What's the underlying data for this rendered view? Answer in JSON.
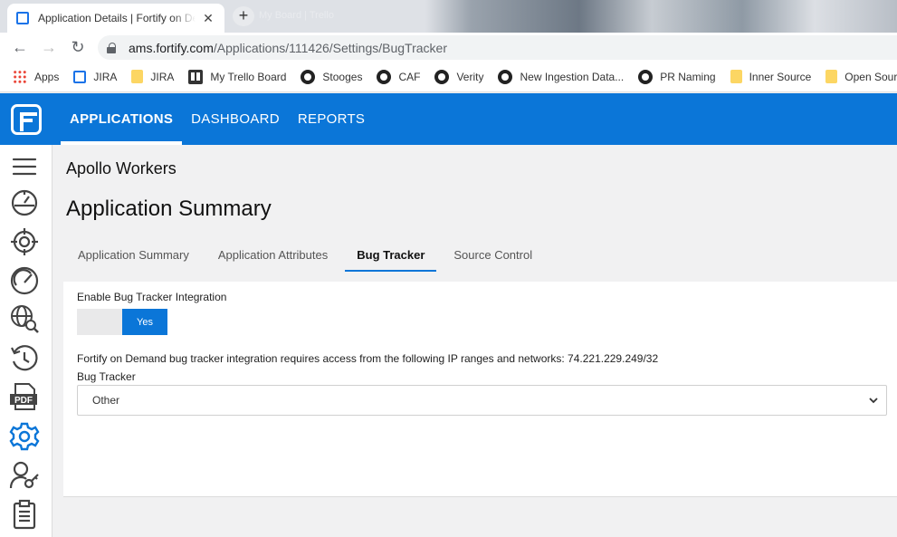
{
  "browser": {
    "tab_title": "Application Details | Fortify on Demand",
    "tab_close": "✕",
    "new_tab": "+",
    "ghost_tab_title": "My Board | Trello",
    "url_host": "ams.fortify.com",
    "url_path": "/Applications/111426/Settings/BugTracker",
    "bookmarks": [
      {
        "label": "Apps",
        "icon": "apps-grid-icon"
      },
      {
        "label": "JIRA",
        "icon": "jira-icon"
      },
      {
        "label": "JIRA",
        "icon": "folder-icon"
      },
      {
        "label": "My Trello Board",
        "icon": "trello-icon"
      },
      {
        "label": "Stooges",
        "icon": "github-icon"
      },
      {
        "label": "CAF",
        "icon": "github-icon"
      },
      {
        "label": "Verity",
        "icon": "github-icon"
      },
      {
        "label": "New Ingestion Data...",
        "icon": "github-icon"
      },
      {
        "label": "PR Naming",
        "icon": "github-icon"
      },
      {
        "label": "Inner Source",
        "icon": "folder-icon"
      },
      {
        "label": "Open Source",
        "icon": "folder-icon"
      }
    ]
  },
  "topnav": {
    "items": [
      "APPLICATIONS",
      "DASHBOARD",
      "REPORTS"
    ],
    "active": "APPLICATIONS"
  },
  "sidebar": {
    "icons": [
      "menu-icon",
      "dashboard-gauge-icon",
      "target-icon",
      "speedometer-icon",
      "globe-search-icon",
      "history-icon",
      "pdf-icon",
      "settings-gear-icon",
      "user-key-icon",
      "clipboard-icon"
    ]
  },
  "main": {
    "app_name": "Apollo Workers",
    "page_title": "Application Summary",
    "tabs": [
      {
        "label": "Application Summary"
      },
      {
        "label": "Application Attributes"
      },
      {
        "label": "Bug Tracker"
      },
      {
        "label": "Source Control"
      }
    ],
    "active_tab": "Bug Tracker",
    "enable_label": "Enable Bug Tracker Integration",
    "toggle_on_label": "Yes",
    "info_text": "Fortify on Demand bug tracker integration requires access from the following IP ranges and networks: 74.221.229.249/32",
    "bug_tracker_label": "Bug Tracker",
    "bug_tracker_value": "Other"
  },
  "colors": {
    "brand_blue": "#0b76d8",
    "icon_blue": "#1a73e8",
    "sidebar_icon": "#444444"
  }
}
